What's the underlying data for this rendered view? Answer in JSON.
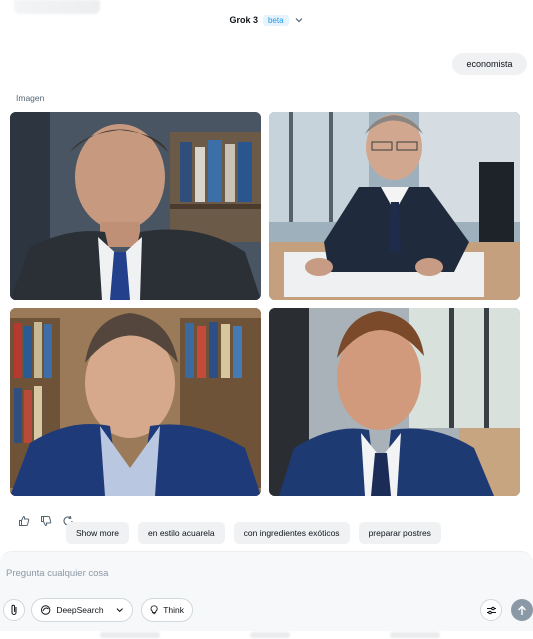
{
  "header": {
    "model_name": "Grok 3",
    "badge": "beta"
  },
  "conversation": {
    "user_message": "economista",
    "section_label": "Imagen",
    "images": [
      {
        "name": "economist-image-1"
      },
      {
        "name": "economist-image-2"
      },
      {
        "name": "economist-image-3"
      },
      {
        "name": "economist-image-4"
      }
    ]
  },
  "actions": {
    "icons": [
      "thumbs-up-icon",
      "thumbs-down-icon",
      "regenerate-icon"
    ]
  },
  "suggestions": [
    "Show more",
    "en estilo acuarela",
    "con ingredientes exóticos",
    "preparar postres"
  ],
  "composer": {
    "placeholder": "Pregunta cualquier cosa",
    "deepsearch_label": "DeepSearch",
    "think_label": "Think"
  },
  "colors": {
    "accent": "#1d9bf0",
    "chip_bg": "#eff1f3",
    "send_button": "#8b98a5"
  }
}
